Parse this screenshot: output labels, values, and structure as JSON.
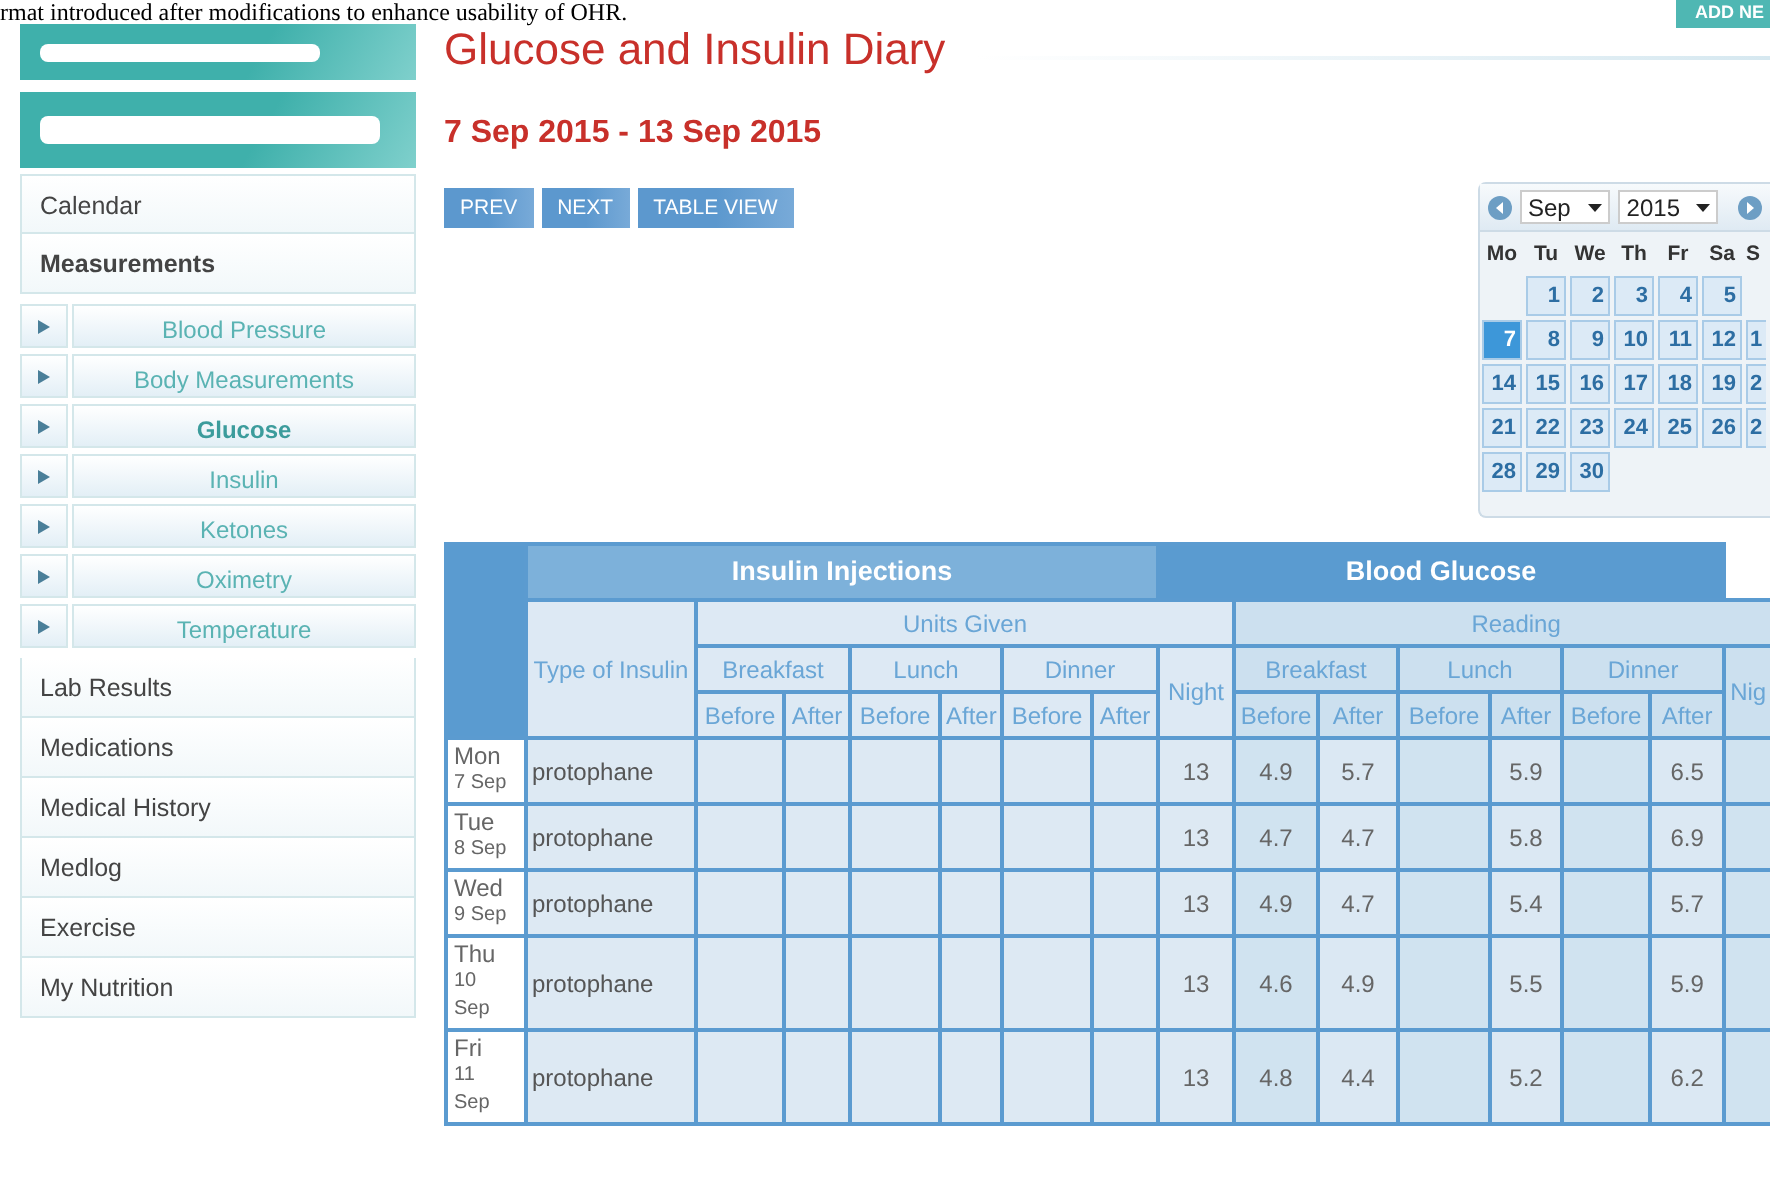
{
  "document_text": "rmat introduced after modifications to enhance usability of OHR.",
  "add_button": "ADD NE",
  "sidebar": {
    "items": [
      {
        "label": "Calendar",
        "selected": false
      },
      {
        "label": "Measurements",
        "selected": true,
        "children": [
          {
            "label": "Blood Pressure",
            "selected": false
          },
          {
            "label": "Body Measurements",
            "selected": false
          },
          {
            "label": "Glucose",
            "selected": true
          },
          {
            "label": "Insulin",
            "selected": false
          },
          {
            "label": "Ketones",
            "selected": false
          },
          {
            "label": "Oximetry",
            "selected": false
          },
          {
            "label": "Temperature",
            "selected": false
          }
        ]
      },
      {
        "label": "Lab Results",
        "selected": false
      },
      {
        "label": "Medications",
        "selected": false
      },
      {
        "label": "Medical History",
        "selected": false
      },
      {
        "label": "Medlog",
        "selected": false
      },
      {
        "label": "Exercise",
        "selected": false
      },
      {
        "label": "My Nutrition",
        "selected": false
      }
    ]
  },
  "title": "Glucose and Insulin Diary",
  "date_range": "7 Sep 2015 - 13 Sep 2015",
  "buttons": [
    "PREV",
    "NEXT",
    "TABLE VIEW"
  ],
  "calendar": {
    "month": "Sep",
    "year": "2015",
    "weekdays": [
      "Mo",
      "Tu",
      "We",
      "Th",
      "Fr",
      "Sa",
      "S"
    ],
    "weeks": [
      {
        "tu": {
          "day": "1",
          "selected": false
        },
        "we": {
          "day": "2",
          "selected": false
        },
        "th": {
          "day": "3",
          "selected": false
        },
        "fr": {
          "day": "4",
          "selected": false
        },
        "sa": {
          "day": "5",
          "selected": false
        }
      },
      {
        "mo": {
          "day": "7",
          "selected": true
        },
        "tu": {
          "day": "8",
          "selected": false
        },
        "we": {
          "day": "9",
          "selected": false
        },
        "th": {
          "day": "10",
          "selected": false
        },
        "fr": {
          "day": "11",
          "selected": false
        },
        "sa": {
          "day": "12",
          "selected": false
        },
        "su": {
          "day": "1",
          "selected": false
        }
      },
      {
        "mo": {
          "day": "14",
          "selected": false
        },
        "tu": {
          "day": "15",
          "selected": false
        },
        "we": {
          "day": "16",
          "selected": false
        },
        "th": {
          "day": "17",
          "selected": false
        },
        "fr": {
          "day": "18",
          "selected": false
        },
        "sa": {
          "day": "19",
          "selected": false
        },
        "su": {
          "day": "2",
          "selected": false
        }
      },
      {
        "mo": {
          "day": "21",
          "selected": false
        },
        "tu": {
          "day": "22",
          "selected": false
        },
        "we": {
          "day": "23",
          "selected": false
        },
        "th": {
          "day": "24",
          "selected": false
        },
        "fr": {
          "day": "25",
          "selected": false
        },
        "sa": {
          "day": "26",
          "selected": false
        },
        "su": {
          "day": "2",
          "selected": false
        }
      },
      {
        "mo": {
          "day": "28",
          "selected": false
        },
        "tu": {
          "day": "29",
          "selected": false
        },
        "we": {
          "day": "30",
          "selected": false
        }
      }
    ]
  },
  "table": {
    "type_header": "Type of Insulin",
    "groups": [
      {
        "title": "Insulin Injections",
        "subtitle": "Units Given",
        "meals": [
          {
            "name": "Breakfast",
            "cols": [
              "Before",
              "After"
            ]
          },
          {
            "name": "Lunch",
            "cols": [
              "Before",
              "After"
            ]
          },
          {
            "name": "Dinner",
            "cols": [
              "Before",
              "After"
            ]
          }
        ],
        "night": "Night"
      },
      {
        "title": "Blood Glucose",
        "subtitle": "Reading",
        "meals": [
          {
            "name": "Breakfast",
            "cols": [
              "Before",
              "After"
            ]
          },
          {
            "name": "Lunch",
            "cols": [
              "Before",
              "After"
            ]
          },
          {
            "name": "Dinner",
            "cols": [
              "Before",
              "After"
            ]
          }
        ],
        "night": "Nig"
      }
    ],
    "rows": [
      {
        "day": "Mon",
        "date": "7 Sep",
        "type": "protophane",
        "insulin": {
          "night": "13"
        },
        "glucose": {
          "breakfast_before": "4.9",
          "breakfast_after": "5.7",
          "lunch_after": "5.9",
          "dinner_after": "6.5"
        }
      },
      {
        "day": "Tue",
        "date": "8 Sep",
        "type": "protophane",
        "insulin": {
          "night": "13"
        },
        "glucose": {
          "breakfast_before": "4.7",
          "breakfast_after": "4.7",
          "lunch_after": "5.8",
          "dinner_after": "6.9"
        }
      },
      {
        "day": "Wed",
        "date": "9 Sep",
        "type": "protophane",
        "insulin": {
          "night": "13"
        },
        "glucose": {
          "breakfast_before": "4.9",
          "breakfast_after": "4.7",
          "lunch_after": "5.4",
          "dinner_after": "5.7"
        }
      },
      {
        "day": "Thu",
        "date": "10 Sep",
        "type": "protophane",
        "insulin": {
          "night": "13"
        },
        "glucose": {
          "breakfast_before": "4.6",
          "breakfast_after": "4.9",
          "lunch_after": "5.5",
          "dinner_after": "5.9"
        }
      },
      {
        "day": "Fri",
        "date": "11 Sep",
        "type": "protophane",
        "insulin": {
          "night": "13"
        },
        "glucose": {
          "breakfast_before": "4.8",
          "breakfast_after": "4.4",
          "lunch_after": "5.2",
          "dinner_after": "6.2"
        }
      }
    ]
  }
}
